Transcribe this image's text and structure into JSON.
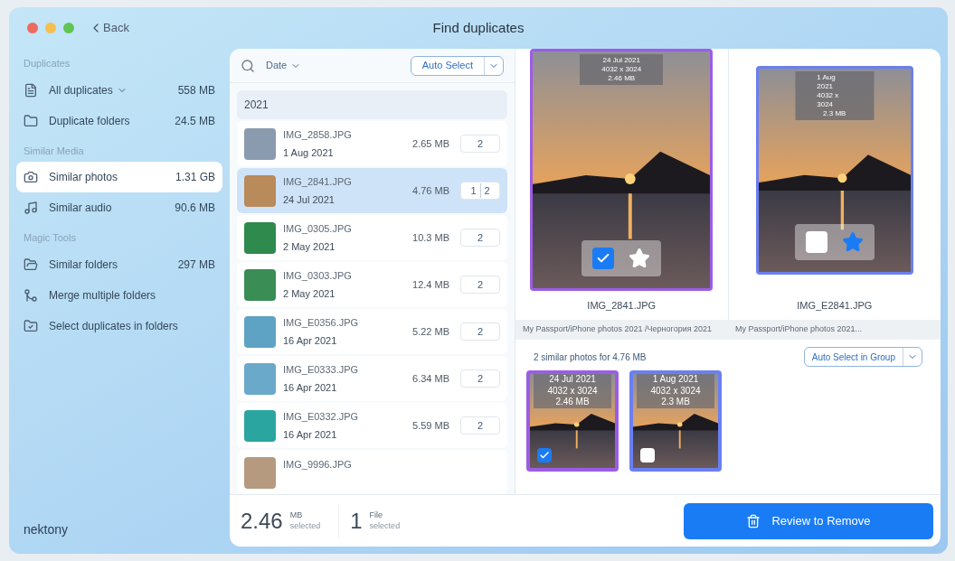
{
  "window": {
    "title": "Find duplicates",
    "back": "Back"
  },
  "sidebar": {
    "sections": [
      {
        "heading": "Duplicates",
        "items": [
          {
            "label": "All duplicates",
            "dropdown": true,
            "size": "558 MB",
            "selected": false
          },
          {
            "label": "Duplicate folders",
            "dropdown": false,
            "size": "24.5 MB",
            "selected": false
          }
        ]
      },
      {
        "heading": "Similar Media",
        "items": [
          {
            "label": "Similar photos",
            "dropdown": false,
            "size": "1.31 GB",
            "selected": true
          },
          {
            "label": "Similar audio",
            "dropdown": false,
            "size": "90.6 MB",
            "selected": false
          }
        ]
      },
      {
        "heading": "Magic Tools",
        "items": [
          {
            "label": "Similar folders",
            "dropdown": false,
            "size": "297 MB",
            "selected": false
          },
          {
            "label": "Merge multiple folders",
            "dropdown": false,
            "selected": false
          },
          {
            "label": "Select duplicates in folders",
            "dropdown": false,
            "selected": false
          }
        ]
      }
    ],
    "logo": "nektony"
  },
  "list": {
    "sort": "Date",
    "auto_select": "Auto Select",
    "group": "2021",
    "rows": [
      {
        "name": "IMG_2858.JPG",
        "date": "1 Aug 2021",
        "size": "2.65 MB",
        "counts": [
          "2"
        ],
        "selected": false
      },
      {
        "name": "IMG_2841.JPG",
        "date": "24 Jul 2021",
        "size": "4.76 MB",
        "counts": [
          "1",
          "2"
        ],
        "selected": true
      },
      {
        "name": "IMG_0305.JPG",
        "date": "2 May 2021",
        "size": "10.3 MB",
        "counts": [
          "2"
        ],
        "selected": false
      },
      {
        "name": "IMG_0303.JPG",
        "date": "2 May 2021",
        "size": "12.4 MB",
        "counts": [
          "2"
        ],
        "selected": false
      },
      {
        "name": "IMG_E0356.JPG",
        "date": "16 Apr 2021",
        "size": "5.22 MB",
        "counts": [
          "2"
        ],
        "selected": false
      },
      {
        "name": "IMG_E0333.JPG",
        "date": "16 Apr 2021",
        "size": "6.34 MB",
        "counts": [
          "2"
        ],
        "selected": false
      },
      {
        "name": "IMG_E0332.JPG",
        "date": "16 Apr 2021",
        "size": "5.59 MB",
        "counts": [
          "2"
        ],
        "selected": false
      },
      {
        "name": "IMG_9996.JPG",
        "selected": false
      }
    ]
  },
  "summary": {
    "size": "2.46",
    "size_unit": "MB",
    "size_caption": "selected",
    "files": "1",
    "files_unit": "File",
    "files_caption": "selected"
  },
  "preview": {
    "photos": [
      {
        "date": "24 Jul 2021",
        "dimensions": "4032 x 3024",
        "size": "2.46 MB",
        "name": "IMG_2841.JPG",
        "path": "My Passport/iPhone photos 2021 /Черногория 2021",
        "color": "#9b5de5",
        "checked": true,
        "starred": false
      },
      {
        "date": "1 Aug 2021",
        "dimensions": "4032 x 3024",
        "size": "2.3 MB",
        "name": "IMG_E2841.JPG",
        "path": "My Passport/iPhone photos 2021...",
        "color": "#6b7ff0",
        "checked": false,
        "starred": true
      }
    ],
    "group_summary": "2 similar photos for 4.76 MB",
    "group_button": "Auto Select in Group",
    "thumbnails": [
      {
        "date": "24 Jul 2021",
        "dimensions": "4032 x 3024",
        "size": "2.46 MB",
        "color": "#9b5de5",
        "checked": true
      },
      {
        "date": "1 Aug 2021",
        "dimensions": "4032 x 3024",
        "size": "2.3 MB",
        "color": "#6b7ff0",
        "checked": false
      }
    ]
  },
  "review_button": "Review to Remove"
}
